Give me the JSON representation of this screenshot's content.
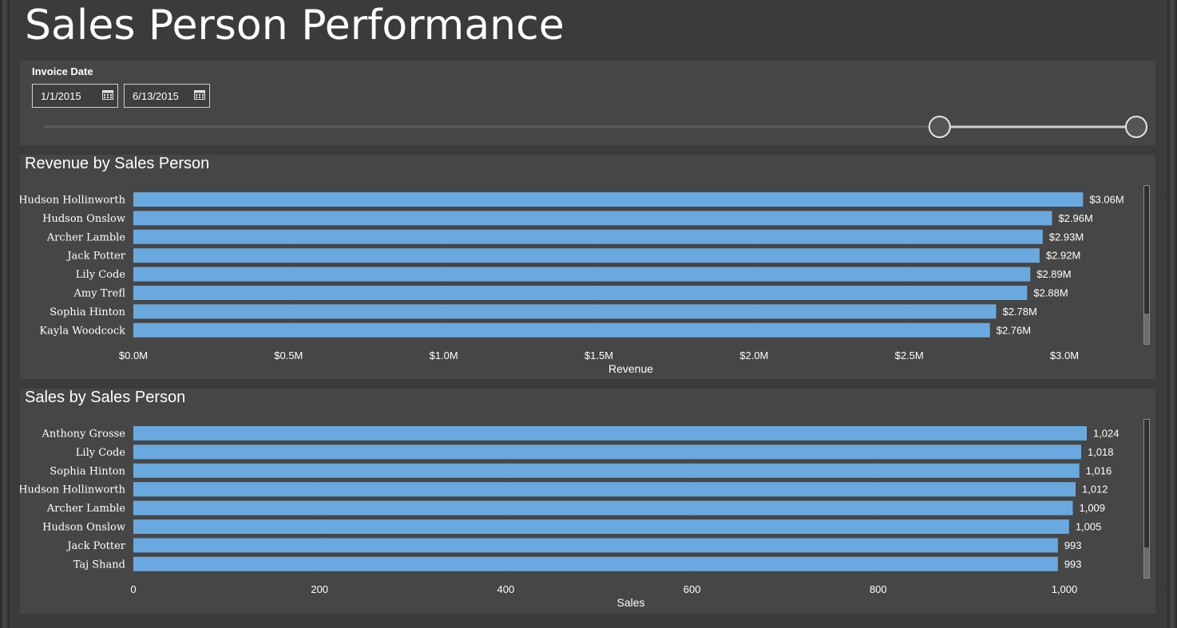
{
  "page": {
    "title": "Sales Person Performance"
  },
  "slicer": {
    "title": "Invoice Date",
    "start_date": "1/1/2015",
    "end_date": "6/13/2015",
    "calendar_icon": "calendar-icon",
    "range_selected": [
      0.82,
      1.0
    ]
  },
  "colors": {
    "bar": "#6aa9df",
    "background": "#3b3b3b",
    "panel": "#464646"
  },
  "chart_data": [
    {
      "type": "bar",
      "orientation": "horizontal",
      "title": "Revenue by Sales Person",
      "xlabel": "Revenue",
      "ylabel": "",
      "categories": [
        "Hudson Hollinworth",
        "Hudson Onslow",
        "Archer Lamble",
        "Jack Potter",
        "Lily Code",
        "Amy Trefl",
        "Sophia Hinton",
        "Kayla Woodcock"
      ],
      "values": [
        3.06,
        2.96,
        2.93,
        2.92,
        2.89,
        2.88,
        2.78,
        2.76
      ],
      "value_labels": [
        "$3.06M",
        "$2.96M",
        "$2.93M",
        "$2.92M",
        "$2.89M",
        "$2.88M",
        "$2.78M",
        "$2.76M"
      ],
      "xlim": [
        0,
        3.0
      ],
      "xticks": [
        0,
        0.5,
        1.0,
        1.5,
        2.0,
        2.5,
        3.0
      ],
      "xtick_labels": [
        "$0.0M",
        "$0.5M",
        "$1.0M",
        "$1.5M",
        "$2.0M",
        "$2.5M",
        "$3.0M"
      ],
      "grid": "vertical dotted"
    },
    {
      "type": "bar",
      "orientation": "horizontal",
      "title": "Sales by Sales Person",
      "xlabel": "Sales",
      "ylabel": "",
      "categories": [
        "Anthony Grosse",
        "Lily Code",
        "Sophia Hinton",
        "Hudson Hollinworth",
        "Archer Lamble",
        "Hudson Onslow",
        "Jack Potter",
        "Taj Shand"
      ],
      "values": [
        1024,
        1018,
        1016,
        1012,
        1009,
        1005,
        993,
        993
      ],
      "value_labels": [
        "1,024",
        "1,018",
        "1,016",
        "1,012",
        "1,009",
        "1,005",
        "993",
        "993"
      ],
      "xlim": [
        0,
        1000
      ],
      "xticks": [
        0,
        200,
        400,
        600,
        800,
        1000
      ],
      "xtick_labels": [
        "0",
        "200",
        "400",
        "600",
        "800",
        "1,000"
      ],
      "grid": "vertical dotted"
    }
  ]
}
